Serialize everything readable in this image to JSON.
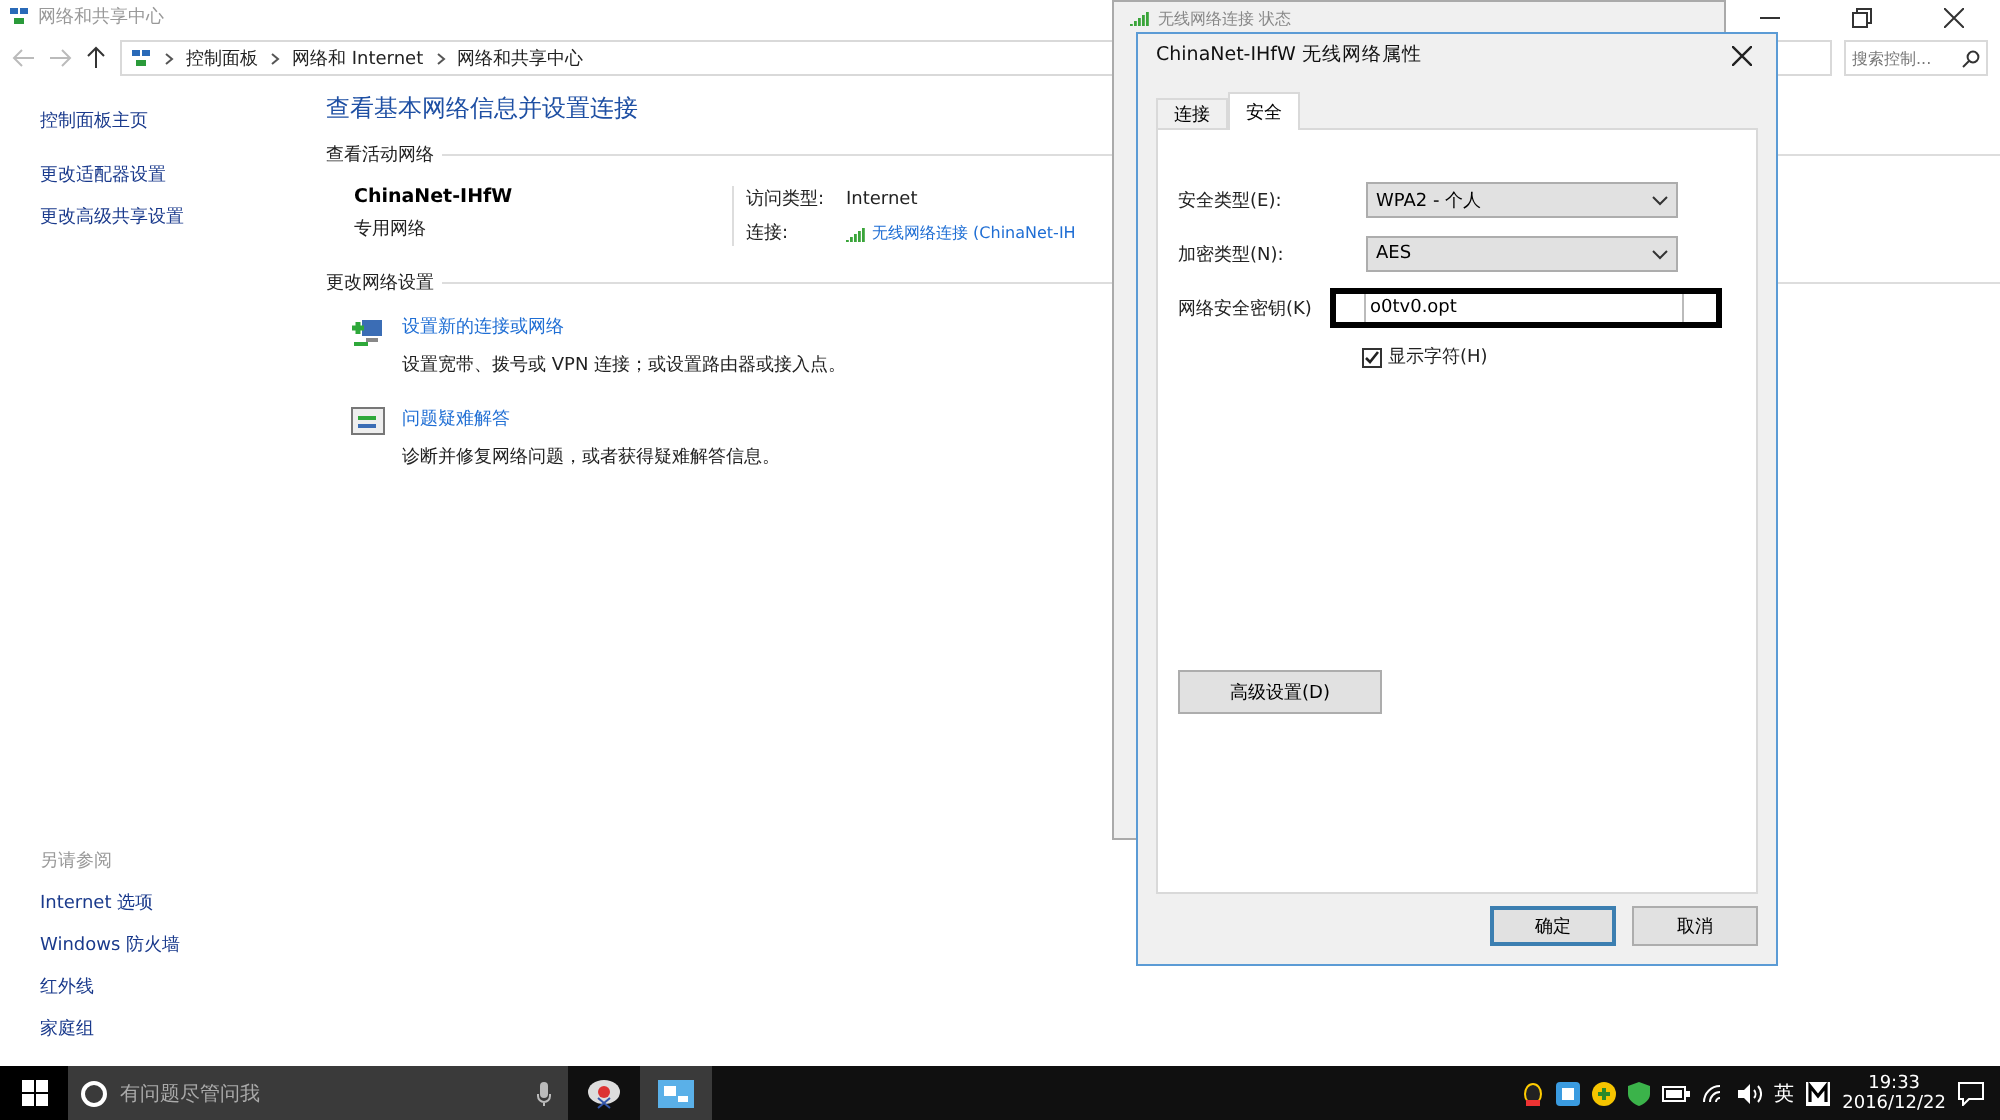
{
  "window": {
    "title": "网络和共享中心"
  },
  "address_bar": {
    "breadcrumb": [
      "控制面板",
      "网络和 Internet",
      "网络和共享中心"
    ],
    "search_placeholder": "搜索控制..."
  },
  "sidebar": {
    "links": [
      "控制面板主页",
      "更改适配器设置",
      "更改高级共享设置"
    ],
    "see_also": {
      "heading": "另请参阅",
      "links": [
        "Internet 选项",
        "Windows 防火墙",
        "红外线",
        "家庭组"
      ]
    }
  },
  "main": {
    "heading": "查看基本网络信息并设置连接",
    "active_label": "查看活动网络",
    "network": {
      "name": "ChinaNet-IHfW",
      "type": "专用网络",
      "access_label": "访问类型:",
      "access_value": "Internet",
      "connection_label": "连接:",
      "connection_value": "无线网络连接 (ChinaNet-IH"
    },
    "change_label": "更改网络设置",
    "tasks": [
      {
        "kind": "setup",
        "title": "设置新的连接或网络",
        "description": "设置宽带、拨号或 VPN 连接；或设置路由器或接入点。"
      },
      {
        "kind": "troubleshoot",
        "title": "问题疑难解答",
        "description": "诊断并修复网络问题，或者获得疑难解答信息。"
      }
    ]
  },
  "status_dialog": {
    "title": "无线网络连接 状态"
  },
  "properties_dialog": {
    "title": "ChinaNet-IHfW 无线网络属性",
    "tabs": [
      {
        "label": "连接",
        "selected": false
      },
      {
        "label": "安全",
        "selected": true
      }
    ],
    "security_type": {
      "label": "安全类型(E):",
      "value": "WPA2 - 个人"
    },
    "encryption_type": {
      "label": "加密类型(N):",
      "value": "AES"
    },
    "key": {
      "label": "网络安全密钥(K)",
      "value": "o0tv0.opt"
    },
    "show_characters": {
      "label": "显示字符(H)",
      "checked": true
    },
    "advanced_button": "高级设置(D)",
    "buttons": [
      {
        "label": "确定",
        "selected": true
      },
      {
        "label": "取消",
        "selected": false
      }
    ]
  },
  "taskbar": {
    "search_placeholder": "有问题尽管问我",
    "ime": "英",
    "time": "19:33",
    "date": "2016/12/22"
  }
}
